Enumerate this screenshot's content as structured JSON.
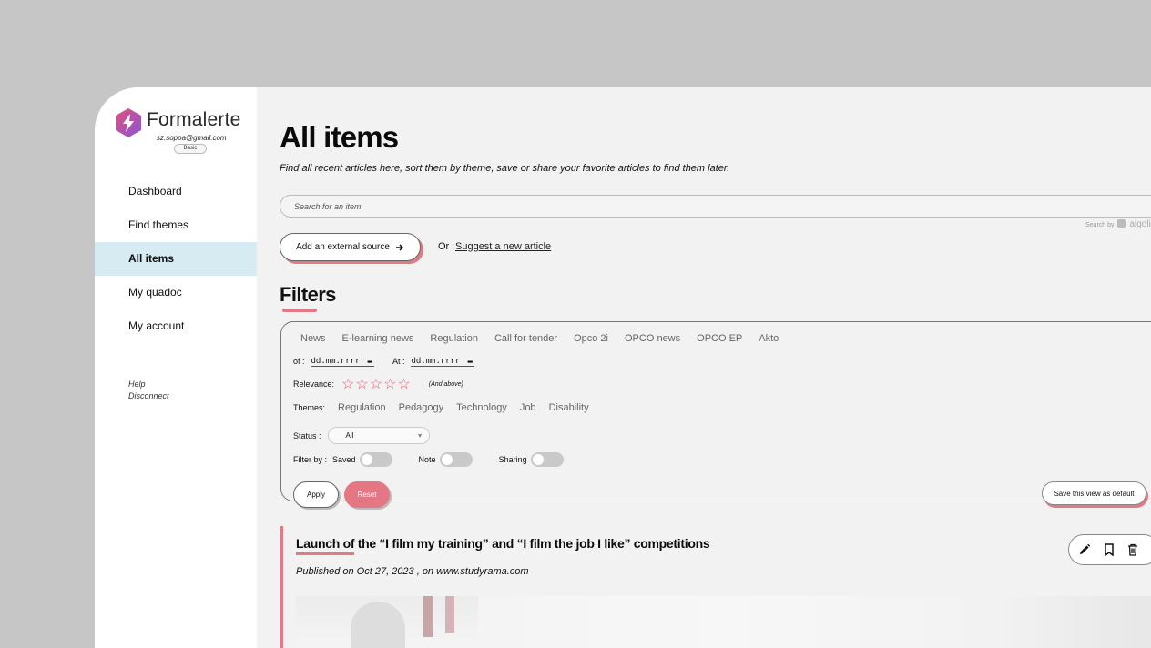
{
  "sidebar": {
    "brand": "Formalerte",
    "email": "sz.soppa@gmail.com",
    "plan": "Basic",
    "logo_colors": [
      "#e0507a",
      "#8a55d8"
    ],
    "nav": [
      {
        "label": "Dashboard",
        "active": false
      },
      {
        "label": "Find themes",
        "active": false
      },
      {
        "label": "All items",
        "active": true
      },
      {
        "label": "My quadoc",
        "active": false
      },
      {
        "label": "My account",
        "active": false
      }
    ],
    "help": "Help",
    "disconnect": "Disconnect"
  },
  "main": {
    "title": "All items",
    "subtitle": "Find all recent articles here, sort them by theme, save or share your favorite articles to find them later.",
    "search_placeholder": "Search for an item",
    "search_by": "Search by",
    "search_provider": "algolia",
    "add_source_label": "Add an external source",
    "or_label": "Or",
    "suggest_label": "Suggest a new article"
  },
  "filters": {
    "title": "Filters",
    "categories": [
      "News",
      "E-learning news",
      "Regulation",
      "Call for tender",
      "Opco 2i",
      "OPCO news",
      "OPCO EP",
      "Akto"
    ],
    "of_label": "of :",
    "at_label": "At :",
    "date_placeholder": "dd.mm.rrrr",
    "relevance_label": "Relevance:",
    "stars": 5,
    "and_above": "(And above)",
    "themes_label": "Themes:",
    "themes": [
      "Regulation",
      "Pedagogy",
      "Technology",
      "Job",
      "Disability"
    ],
    "status_label": "Status :",
    "status_value": "All",
    "filter_by_label": "Filter by :",
    "toggles": [
      {
        "label": "Saved",
        "on": false
      },
      {
        "label": "Note",
        "on": false
      },
      {
        "label": "Sharing",
        "on": false
      }
    ],
    "apply_label": "Apply",
    "reset_label": "Reset",
    "save_view_label": "Save this view as default",
    "accent_color": "#e47783"
  },
  "article": {
    "title": "Launch of the “I film my training” and “I film the job I like” competitions",
    "meta": "Published on Oct 27, 2023 , on www.studyrama.com"
  }
}
